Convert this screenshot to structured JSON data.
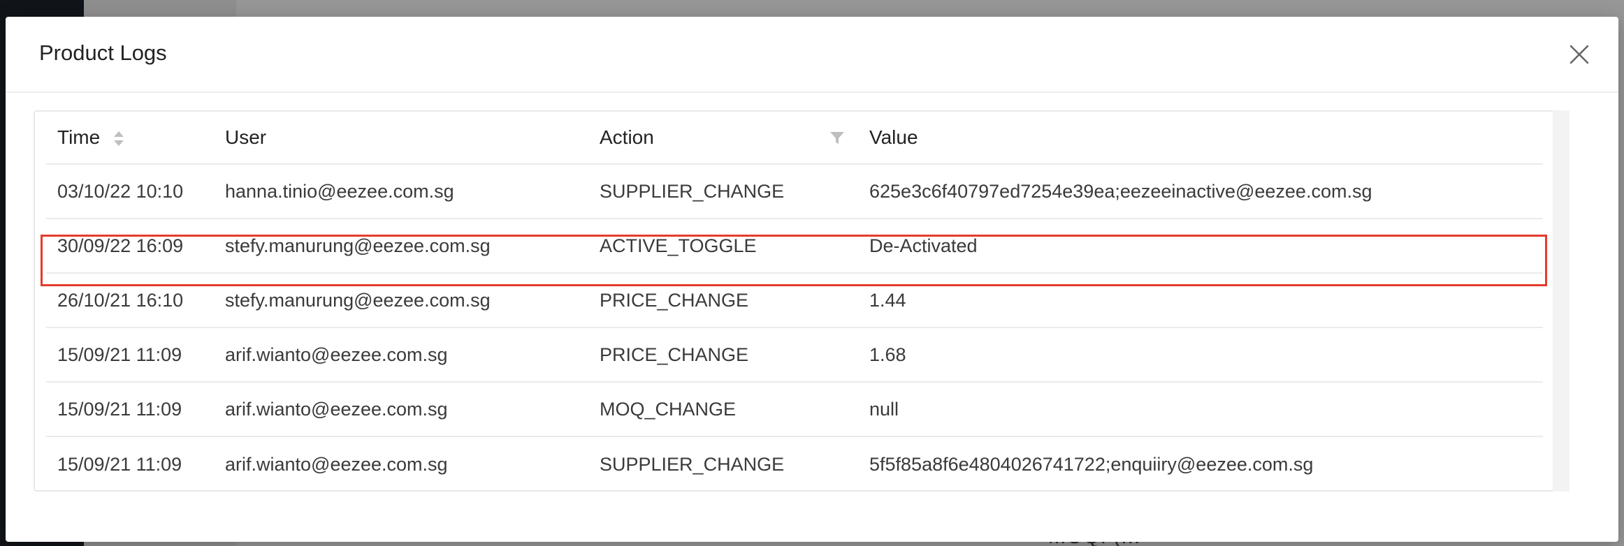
{
  "backdrop": {
    "peek_text": "MOQ: (..."
  },
  "modal": {
    "title": "Product Logs",
    "close_icon": "close-icon"
  },
  "table": {
    "columns": [
      {
        "label": "Time",
        "sortable": true
      },
      {
        "label": "User"
      },
      {
        "label": "Action",
        "filterable": true
      },
      {
        "label": "Value"
      }
    ],
    "rows": [
      {
        "time": "03/10/22 10:10",
        "user": "hanna.tinio@eezee.com.sg",
        "action": "SUPPLIER_CHANGE",
        "value": "625e3c6f40797ed7254e39ea;eezeeinactive@eezee.com.sg"
      },
      {
        "time": "30/09/22 16:09",
        "user": "stefy.manurung@eezee.com.sg",
        "action": "ACTIVE_TOGGLE",
        "value": "De-Activated",
        "highlighted": true
      },
      {
        "time": "26/10/21 16:10",
        "user": "stefy.manurung@eezee.com.sg",
        "action": "PRICE_CHANGE",
        "value": "1.44"
      },
      {
        "time": "15/09/21 11:09",
        "user": "arif.wianto@eezee.com.sg",
        "action": "PRICE_CHANGE",
        "value": "1.68"
      },
      {
        "time": "15/09/21 11:09",
        "user": "arif.wianto@eezee.com.sg",
        "action": "MOQ_CHANGE",
        "value": "null"
      },
      {
        "time": "15/09/21 11:09",
        "user": "arif.wianto@eezee.com.sg",
        "action": "SUPPLIER_CHANGE",
        "value": "5f5f85a8f6e4804026741722;enquiiry@eezee.com.sg"
      }
    ]
  },
  "colors": {
    "highlight": "#e53b2c",
    "border": "#e8e8e8"
  }
}
